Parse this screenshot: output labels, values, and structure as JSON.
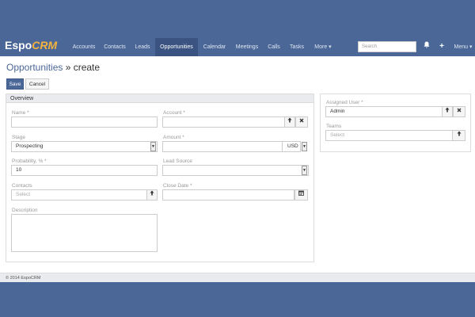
{
  "brand": {
    "espo": "Espo",
    "crm": "CRM"
  },
  "nav": {
    "items": [
      "Accounts",
      "Contacts",
      "Leads",
      "Opportunities",
      "Calendar",
      "Meetings",
      "Calls",
      "Tasks",
      "More ▾"
    ],
    "active": "Opportunities",
    "search_placeholder": "Search",
    "menu": "Menu ▾",
    "bell_icon": "bell-icon",
    "plus_icon": "plus-icon"
  },
  "page": {
    "breadcrumb_link": "Opportunities",
    "breadcrumb_rest": " » create"
  },
  "buttons": {
    "save": "Save",
    "cancel": "Cancel"
  },
  "overview": {
    "title": "Overview",
    "name_label": "Name *",
    "account_label": "Account *",
    "stage_label": "Stage",
    "stage_value": "Prospecting",
    "amount_label": "Amount *",
    "currency": "USD",
    "probability_label": "Probability, % *",
    "probability_value": "10",
    "lead_source_label": "Lead Source",
    "contacts_label": "Contacts",
    "contacts_placeholder": "Select",
    "close_date_label": "Close Date *",
    "description_label": "Description"
  },
  "side": {
    "assigned_user_label": "Assigned User *",
    "assigned_user_value": "Admin",
    "teams_label": "Teams",
    "teams_placeholder": "Select"
  },
  "footer": {
    "text": "© 2014 EspoCRM"
  },
  "colors": {
    "brand_blue": "#4a6798",
    "accent_orange": "#f4b33f"
  }
}
